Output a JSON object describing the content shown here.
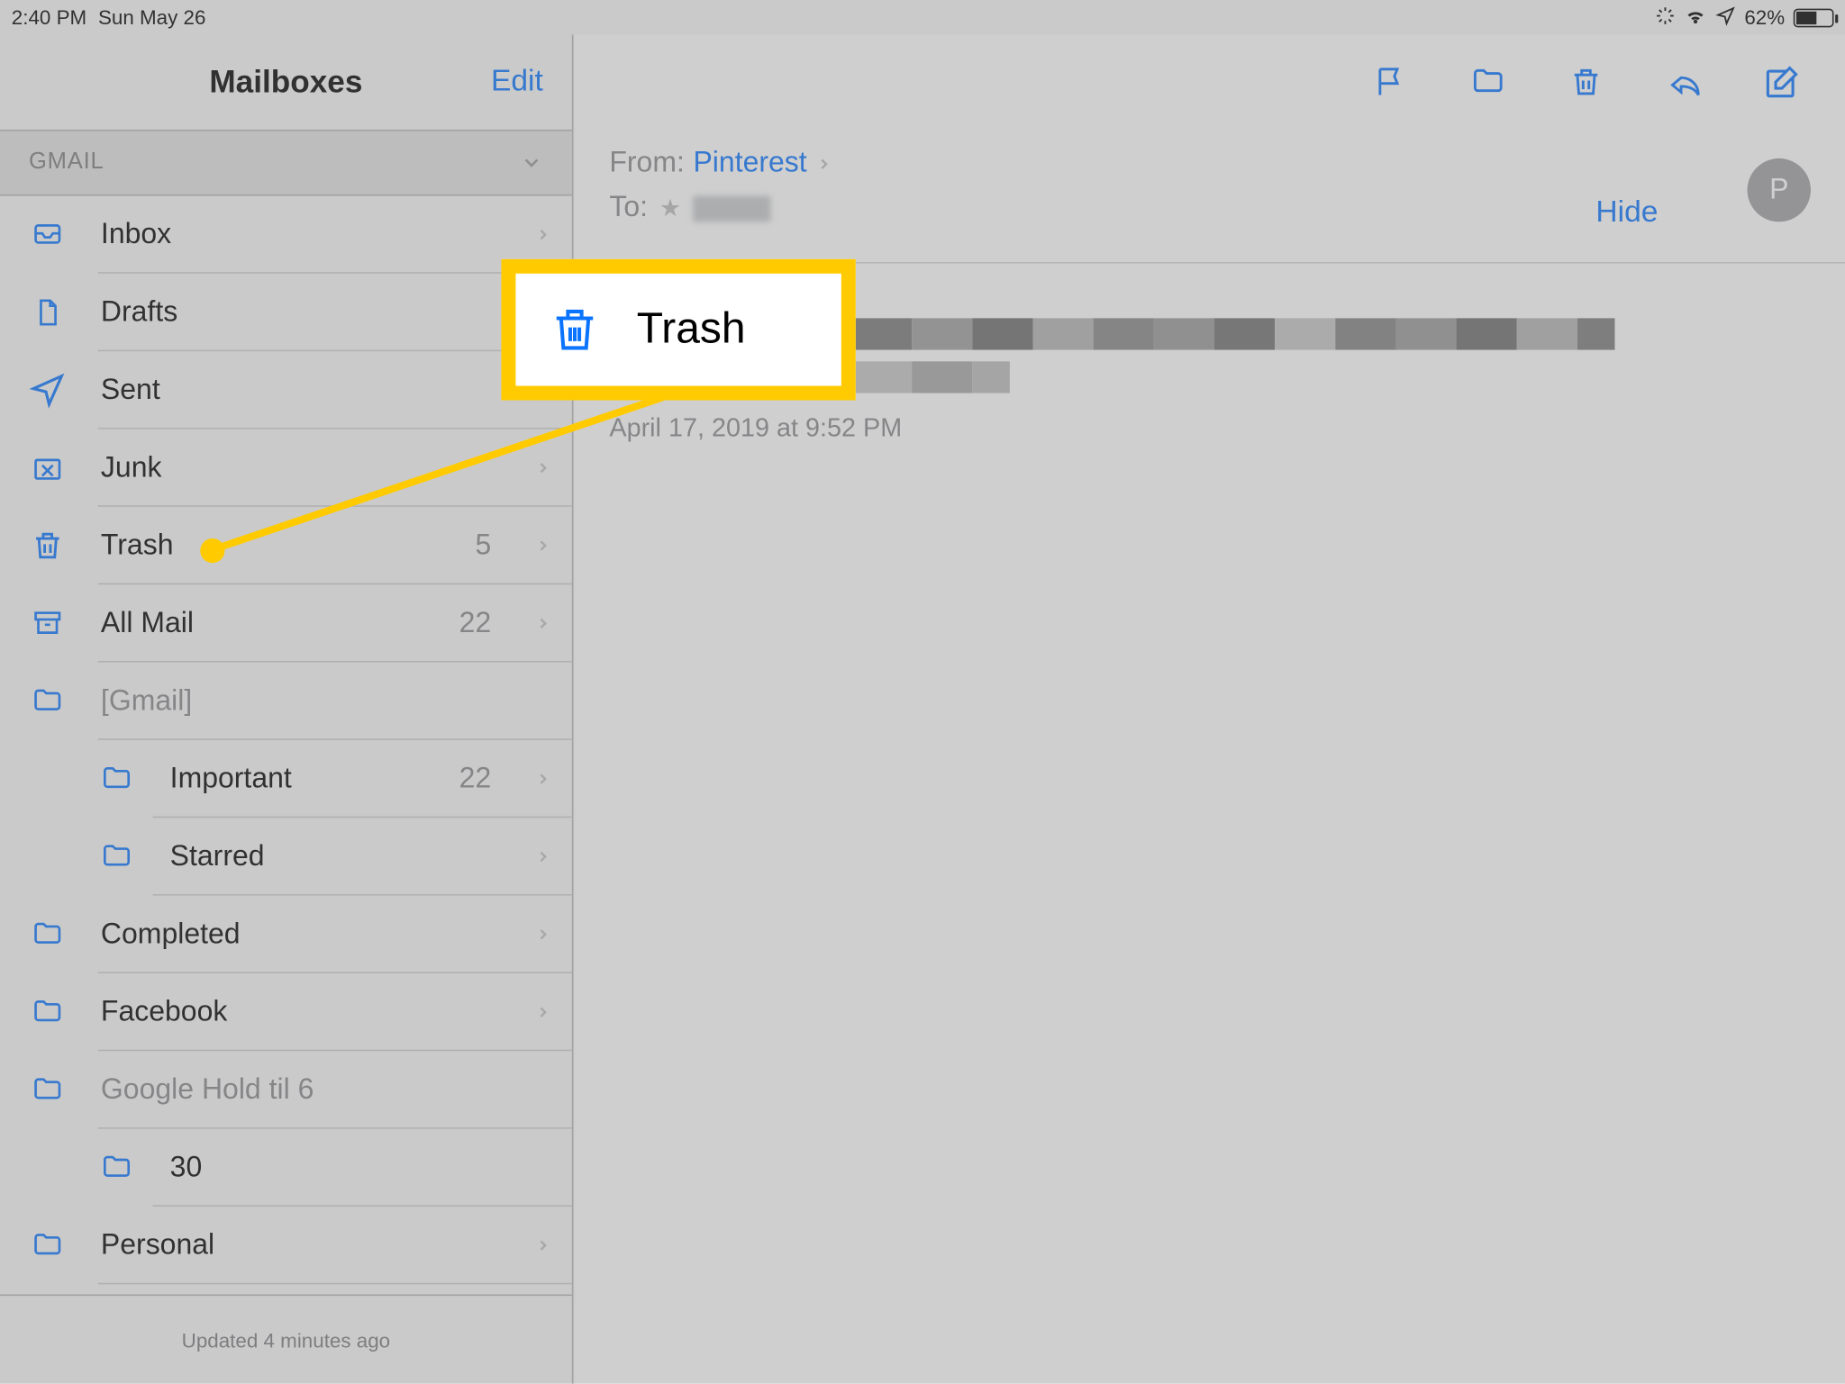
{
  "status_bar": {
    "time": "2:40 PM",
    "date": "Sun May 26",
    "battery_pct": "62%"
  },
  "sidebar": {
    "title": "Mailboxes",
    "edit_label": "Edit",
    "section_label": "GMAIL",
    "footer": "Updated 4 minutes ago",
    "rows": [
      {
        "icon": "inbox-icon",
        "label": "Inbox",
        "count": "",
        "chevron": true,
        "indent": false,
        "muted": false
      },
      {
        "icon": "drafts-icon",
        "label": "Drafts",
        "count": "",
        "chevron": false,
        "indent": false,
        "muted": false
      },
      {
        "icon": "sent-icon",
        "label": "Sent",
        "count": "",
        "chevron": false,
        "indent": false,
        "muted": false
      },
      {
        "icon": "junk-icon",
        "label": "Junk",
        "count": "",
        "chevron": true,
        "indent": false,
        "muted": false
      },
      {
        "icon": "trash-icon",
        "label": "Trash",
        "count": "5",
        "chevron": true,
        "indent": false,
        "muted": false
      },
      {
        "icon": "archive-icon",
        "label": "All Mail",
        "count": "22",
        "chevron": true,
        "indent": false,
        "muted": false
      },
      {
        "icon": "folder-icon",
        "label": "[Gmail]",
        "count": "",
        "chevron": false,
        "indent": false,
        "muted": true
      },
      {
        "icon": "folder-icon",
        "label": "Important",
        "count": "22",
        "chevron": true,
        "indent": true,
        "muted": false
      },
      {
        "icon": "folder-icon",
        "label": "Starred",
        "count": "",
        "chevron": true,
        "indent": true,
        "muted": false
      },
      {
        "icon": "folder-icon",
        "label": "Completed",
        "count": "",
        "chevron": true,
        "indent": false,
        "muted": false
      },
      {
        "icon": "folder-icon",
        "label": "Facebook",
        "count": "",
        "chevron": true,
        "indent": false,
        "muted": false
      },
      {
        "icon": "folder-icon",
        "label": "Google Hold til 6",
        "count": "",
        "chevron": false,
        "indent": false,
        "muted": true
      },
      {
        "icon": "folder-icon",
        "label": "30",
        "count": "",
        "chevron": false,
        "indent": true,
        "muted": false
      },
      {
        "icon": "folder-icon",
        "label": "Personal",
        "count": "",
        "chevron": true,
        "indent": false,
        "muted": false
      }
    ]
  },
  "toolbar_icons": [
    "flag-icon",
    "folder-icon",
    "trash-icon",
    "reply-icon",
    "compose-icon"
  ],
  "mail": {
    "from_label": "From:",
    "from_sender": "Pinterest",
    "to_label": "To:",
    "hide_label": "Hide",
    "avatar_initial": "P",
    "date": "April 17, 2019 at 9:52 PM"
  },
  "callout": {
    "label": "Trash"
  },
  "colors": {
    "accent": "#0b74ff",
    "highlight": "#ffcb00"
  }
}
